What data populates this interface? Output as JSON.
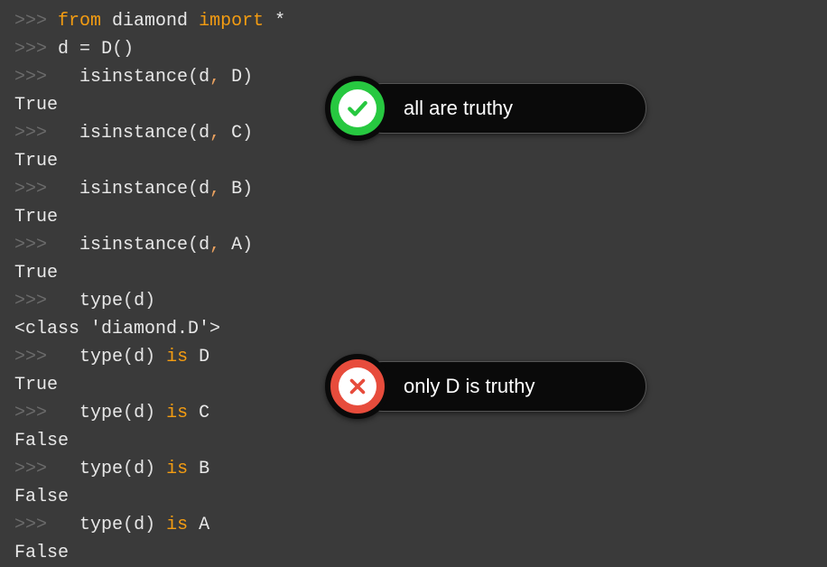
{
  "code": {
    "prompt": ">>>",
    "lines": [
      {
        "type": "input",
        "tokens": [
          {
            "cls": "kw-from",
            "t": "from"
          },
          {
            "cls": "sp",
            "t": " "
          },
          {
            "cls": "name",
            "t": "diamond"
          },
          {
            "cls": "sp",
            "t": " "
          },
          {
            "cls": "kw-import",
            "t": "import"
          },
          {
            "cls": "sp",
            "t": " "
          },
          {
            "cls": "star",
            "t": "*"
          }
        ]
      },
      {
        "type": "input",
        "tokens": [
          {
            "cls": "name",
            "t": "d"
          },
          {
            "cls": "sp",
            "t": " "
          },
          {
            "cls": "op",
            "t": "="
          },
          {
            "cls": "sp",
            "t": " "
          },
          {
            "cls": "name",
            "t": "D"
          },
          {
            "cls": "paren",
            "t": "()"
          }
        ]
      },
      {
        "type": "input",
        "indent": "  ",
        "tokens": [
          {
            "cls": "name",
            "t": "isinstance"
          },
          {
            "cls": "paren",
            "t": "("
          },
          {
            "cls": "name",
            "t": "d"
          },
          {
            "cls": "comma",
            "t": ","
          },
          {
            "cls": "sp",
            "t": " "
          },
          {
            "cls": "arg2",
            "t": "D"
          },
          {
            "cls": "paren",
            "t": ")"
          }
        ]
      },
      {
        "type": "output",
        "text": "True"
      },
      {
        "type": "input",
        "indent": "  ",
        "tokens": [
          {
            "cls": "name",
            "t": "isinstance"
          },
          {
            "cls": "paren",
            "t": "("
          },
          {
            "cls": "name",
            "t": "d"
          },
          {
            "cls": "comma",
            "t": ","
          },
          {
            "cls": "sp",
            "t": " "
          },
          {
            "cls": "arg2",
            "t": "C"
          },
          {
            "cls": "paren",
            "t": ")"
          }
        ]
      },
      {
        "type": "output",
        "text": "True"
      },
      {
        "type": "input",
        "indent": "  ",
        "tokens": [
          {
            "cls": "name",
            "t": "isinstance"
          },
          {
            "cls": "paren",
            "t": "("
          },
          {
            "cls": "name",
            "t": "d"
          },
          {
            "cls": "comma",
            "t": ","
          },
          {
            "cls": "sp",
            "t": " "
          },
          {
            "cls": "arg2",
            "t": "B"
          },
          {
            "cls": "paren",
            "t": ")"
          }
        ]
      },
      {
        "type": "output",
        "text": "True"
      },
      {
        "type": "input",
        "indent": "  ",
        "tokens": [
          {
            "cls": "name",
            "t": "isinstance"
          },
          {
            "cls": "paren",
            "t": "("
          },
          {
            "cls": "name",
            "t": "d"
          },
          {
            "cls": "comma",
            "t": ","
          },
          {
            "cls": "sp",
            "t": " "
          },
          {
            "cls": "arg2",
            "t": "A"
          },
          {
            "cls": "paren",
            "t": ")"
          }
        ]
      },
      {
        "type": "output",
        "text": "True"
      },
      {
        "type": "input",
        "indent": "  ",
        "tokens": [
          {
            "cls": "name",
            "t": "type"
          },
          {
            "cls": "paren",
            "t": "("
          },
          {
            "cls": "name",
            "t": "d"
          },
          {
            "cls": "paren",
            "t": ")"
          }
        ]
      },
      {
        "type": "output",
        "text": "<class 'diamond.D'>"
      },
      {
        "type": "input",
        "indent": "  ",
        "tokens": [
          {
            "cls": "name",
            "t": "type"
          },
          {
            "cls": "paren",
            "t": "("
          },
          {
            "cls": "name",
            "t": "d"
          },
          {
            "cls": "paren",
            "t": ")"
          },
          {
            "cls": "sp",
            "t": " "
          },
          {
            "cls": "kw-is",
            "t": "is"
          },
          {
            "cls": "sp",
            "t": " "
          },
          {
            "cls": "name",
            "t": "D"
          }
        ]
      },
      {
        "type": "output",
        "text": "True"
      },
      {
        "type": "input",
        "indent": "  ",
        "tokens": [
          {
            "cls": "name",
            "t": "type"
          },
          {
            "cls": "paren",
            "t": "("
          },
          {
            "cls": "name",
            "t": "d"
          },
          {
            "cls": "paren",
            "t": ")"
          },
          {
            "cls": "sp",
            "t": " "
          },
          {
            "cls": "kw-is",
            "t": "is"
          },
          {
            "cls": "sp",
            "t": " "
          },
          {
            "cls": "name",
            "t": "C"
          }
        ]
      },
      {
        "type": "output",
        "text": "False"
      },
      {
        "type": "input",
        "indent": "  ",
        "tokens": [
          {
            "cls": "name",
            "t": "type"
          },
          {
            "cls": "paren",
            "t": "("
          },
          {
            "cls": "name",
            "t": "d"
          },
          {
            "cls": "paren",
            "t": ")"
          },
          {
            "cls": "sp",
            "t": " "
          },
          {
            "cls": "kw-is",
            "t": "is"
          },
          {
            "cls": "sp",
            "t": " "
          },
          {
            "cls": "name",
            "t": "B"
          }
        ]
      },
      {
        "type": "output",
        "text": "False"
      },
      {
        "type": "input",
        "indent": "  ",
        "tokens": [
          {
            "cls": "name",
            "t": "type"
          },
          {
            "cls": "paren",
            "t": "("
          },
          {
            "cls": "name",
            "t": "d"
          },
          {
            "cls": "paren",
            "t": ")"
          },
          {
            "cls": "sp",
            "t": " "
          },
          {
            "cls": "kw-is",
            "t": "is"
          },
          {
            "cls": "sp",
            "t": " "
          },
          {
            "cls": "name",
            "t": "A"
          }
        ]
      },
      {
        "type": "output",
        "text": "False"
      }
    ]
  },
  "badges": {
    "truthy": {
      "label": "all are truthy",
      "icon": "check-icon",
      "color": "green"
    },
    "falsy": {
      "label": "only D is truthy",
      "icon": "cross-icon",
      "color": "red"
    }
  }
}
